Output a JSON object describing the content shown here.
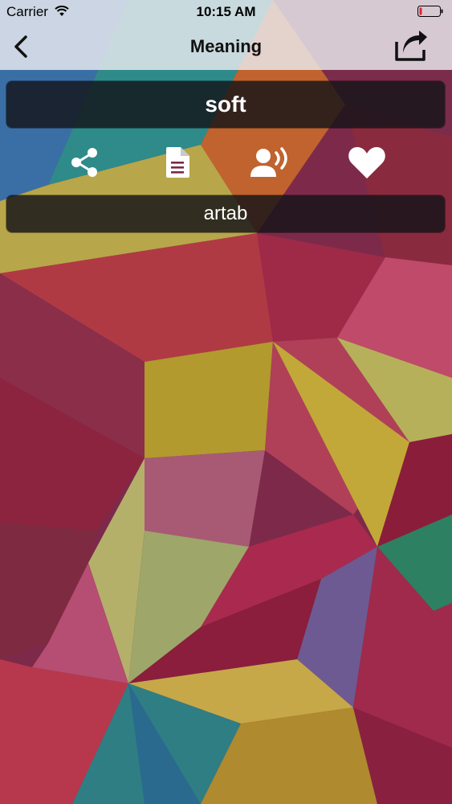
{
  "status_bar": {
    "carrier": "Carrier",
    "time": "10:15 AM",
    "battery_icon": "battery-low-icon",
    "wifi_icon": "wifi-icon"
  },
  "nav": {
    "title": "Meaning",
    "back_icon": "chevron-left-icon",
    "share_icon": "share-out-icon"
  },
  "word": "soft",
  "actions": [
    {
      "name": "share",
      "icon": "share-icon"
    },
    {
      "name": "copy",
      "icon": "document-icon"
    },
    {
      "name": "speak",
      "icon": "speaker-person-icon"
    },
    {
      "name": "favorite",
      "icon": "heart-icon"
    }
  ],
  "meaning": "artab",
  "colors": {
    "battery_low": "#e0242c",
    "panel_bg": "#141418",
    "text_light": "#ffffff"
  }
}
